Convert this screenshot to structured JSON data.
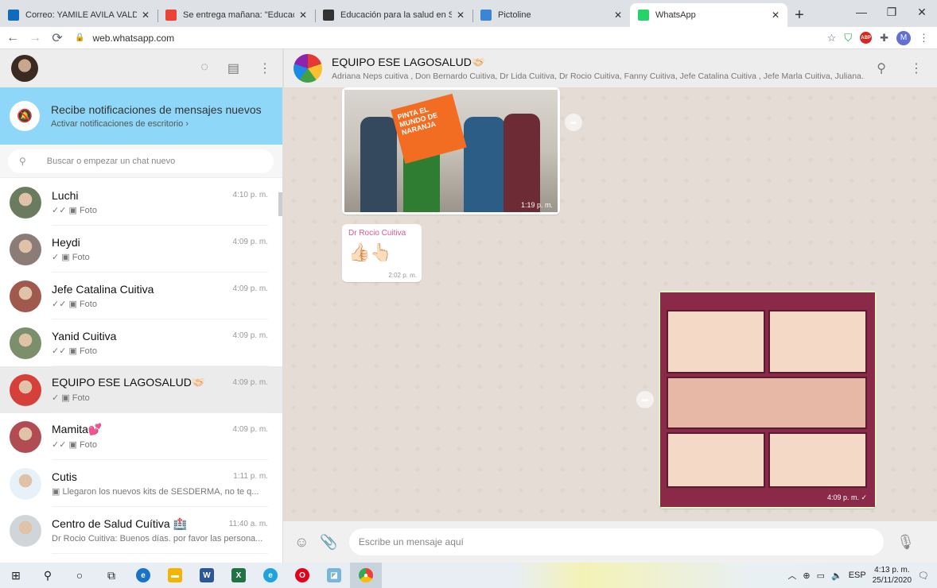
{
  "browser": {
    "tabs": [
      {
        "title": "Correo: YAMILE AVILA VALDES - O",
        "fav": "outlook",
        "color": "#0f6cbd"
      },
      {
        "title": "Se entrega mañana: \"Educación p",
        "fav": "gmail",
        "color": "#ea4335"
      },
      {
        "title": "Educación para la salud en Salud",
        "fav": "classroom",
        "color": "#333"
      },
      {
        "title": "Pictoline",
        "fav": "pictoline",
        "color": "#3a86d4"
      },
      {
        "title": "WhatsApp",
        "fav": "whatsapp",
        "color": "#25d366"
      }
    ],
    "url": "web.whatsapp.com"
  },
  "sidebar": {
    "notification": {
      "title": "Recibe notificaciones de mensajes nuevos",
      "subtitle": "Activar notificaciones de escritorio ›"
    },
    "search_placeholder": "Buscar o empezar un chat nuevo",
    "chats": [
      {
        "name": "Luchi",
        "time": "4:10 p. m.",
        "last": "✓✓ ▣ Foto",
        "color": "#6a7b5e"
      },
      {
        "name": "Heydi",
        "time": "4:09 p. m.",
        "last": "✓ ▣ Foto",
        "color": "#8b7c77"
      },
      {
        "name": "Jefe Catalina Cuitiva",
        "time": "4:09 p. m.",
        "last": "✓✓ ▣ Foto",
        "color": "#a05a4d"
      },
      {
        "name": "Yanid Cuitiva",
        "time": "4:09 p. m.",
        "last": "✓✓ ▣ Foto",
        "color": "#7a8f6a"
      },
      {
        "name": "EQUIPO ESE LAGOSALUD🤝🏻",
        "time": "4:09 p. m.",
        "last": "✓ ▣ Foto",
        "color": "#d6403a"
      },
      {
        "name": "Mamita💕",
        "time": "4:09 p. m.",
        "last": "✓✓ ▣ Foto",
        "color": "#b14c52"
      },
      {
        "name": "Cutis",
        "time": "1:11 p. m.",
        "last": "▣ Llegaron los nuevos kits de SESDERMA,  no te q...",
        "color": "#e8f1f8"
      },
      {
        "name": "Centro de Salud Cuítiva 🏥",
        "time": "11:40 a. m.",
        "last": "Dr Rocio Cuitiva: Buenos días. por favor las persona...",
        "color": "#cfd5d9"
      }
    ]
  },
  "conversation": {
    "title": "EQUIPO ESE LAGOSALUD🤝🏻",
    "members": "Adriana Neps cuitiva , Don Bernardo Cuitiva, Dr Lida Cuitiva, Dr Rocio Cuitiva, Fanny Cuitiva, Jefe Catalina Cuitiva , Jefe Marla Cuitiva, Juliana...",
    "photo1_time": "1:19 p. m.",
    "photo1_sign": "PINTA EL MUNDO DE NARANJA",
    "msg2_sender": "Dr Rocio Cuitiva",
    "msg2_emoji": "👍🏻👆🏻",
    "msg2_time": "2:02 p. m.",
    "photo2_time": "4:09 p. m. ✓",
    "compose_placeholder": "Escribe un mensaje aquí"
  },
  "taskbar": {
    "lang": "ESP",
    "time": "4:13 p. m.",
    "date": "25/11/2020"
  }
}
